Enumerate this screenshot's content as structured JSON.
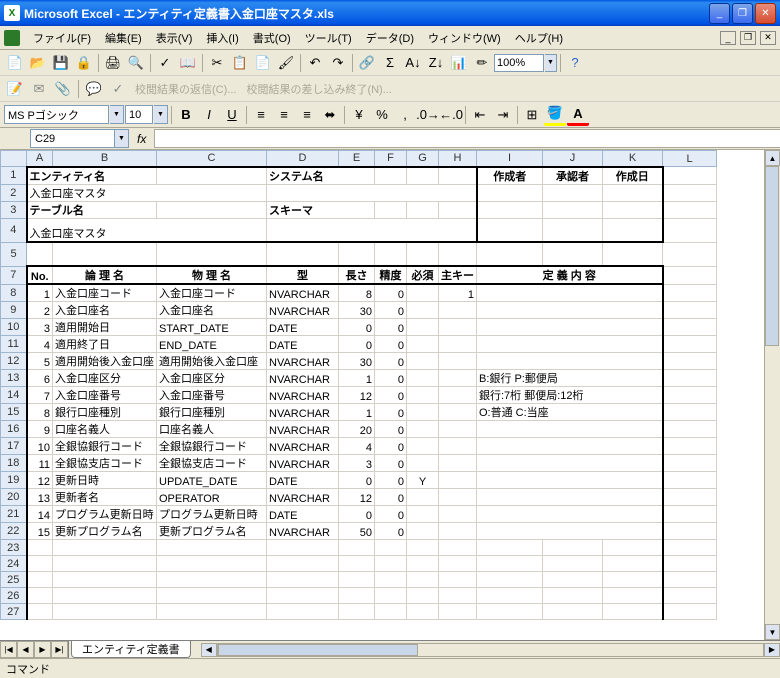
{
  "title": "Microsoft Excel - エンティティ定義書入金口座マスタ.xls",
  "menus": {
    "file": "ファイル(F)",
    "edit": "編集(E)",
    "view": "表示(V)",
    "insert": "挿入(I)",
    "format": "書式(O)",
    "tools": "ツール(T)",
    "data": "データ(D)",
    "window": "ウィンドウ(W)",
    "help": "ヘルプ(H)"
  },
  "toolbar3": {
    "review_reply": "校閲結果の返信(C)...",
    "review_end": "校閲結果の差し込み終了(N)..."
  },
  "format": {
    "font_name": "MS Pゴシック",
    "font_size": "10",
    "zoom": "100%"
  },
  "namebox": "C29",
  "columns": [
    "A",
    "B",
    "C",
    "D",
    "E",
    "F",
    "G",
    "H",
    "I",
    "J",
    "K",
    "L"
  ],
  "header_cells": {
    "entity_label": "エンティティ名",
    "system_label": "システム名",
    "creator": "作成者",
    "approver": "承認者",
    "created_date": "作成日",
    "entity_value": "入金口座マスタ",
    "table_label": "テーブル名",
    "schema_label": "スキーマ",
    "table_value": "入金口座マスタ"
  },
  "column_headers": {
    "no": "No.",
    "logical": "論 理 名",
    "physical": "物 理 名",
    "type": "型",
    "length": "長さ",
    "precision": "精度",
    "required": "必須",
    "pk": "主キー",
    "definition": "定 義 内 容"
  },
  "rows": [
    {
      "no": 1,
      "logical": "入金口座コード",
      "physical": "入金口座コード",
      "type": "NVARCHAR",
      "len": 8,
      "prec": 0,
      "req": "",
      "pk": "1",
      "def": ""
    },
    {
      "no": 2,
      "logical": "入金口座名",
      "physical": "入金口座名",
      "type": "NVARCHAR",
      "len": 30,
      "prec": 0,
      "req": "",
      "pk": "",
      "def": ""
    },
    {
      "no": 3,
      "logical": "適用開始日",
      "physical": "START_DATE",
      "type": "DATE",
      "len": 0,
      "prec": 0,
      "req": "",
      "pk": "",
      "def": ""
    },
    {
      "no": 4,
      "logical": "適用終了日",
      "physical": "END_DATE",
      "type": "DATE",
      "len": 0,
      "prec": 0,
      "req": "",
      "pk": "",
      "def": ""
    },
    {
      "no": 5,
      "logical": "適用開始後入金口座",
      "physical": "適用開始後入金口座",
      "type": "NVARCHAR",
      "len": 30,
      "prec": 0,
      "req": "",
      "pk": "",
      "def": ""
    },
    {
      "no": 6,
      "logical": "入金口座区分",
      "physical": "入金口座区分",
      "type": "NVARCHAR",
      "len": 1,
      "prec": 0,
      "req": "",
      "pk": "",
      "def": "B:銀行 P:郵便局"
    },
    {
      "no": 7,
      "logical": "入金口座番号",
      "physical": "入金口座番号",
      "type": "NVARCHAR",
      "len": 12,
      "prec": 0,
      "req": "",
      "pk": "",
      "def": "銀行:7桁 郵便局:12桁"
    },
    {
      "no": 8,
      "logical": "銀行口座種別",
      "physical": "銀行口座種別",
      "type": "NVARCHAR",
      "len": 1,
      "prec": 0,
      "req": "",
      "pk": "",
      "def": "O:普通 C:当座"
    },
    {
      "no": 9,
      "logical": "口座名義人",
      "physical": "口座名義人",
      "type": "NVARCHAR",
      "len": 20,
      "prec": 0,
      "req": "",
      "pk": "",
      "def": ""
    },
    {
      "no": 10,
      "logical": "全銀協銀行コード",
      "physical": "全銀協銀行コード",
      "type": "NVARCHAR",
      "len": 4,
      "prec": 0,
      "req": "",
      "pk": "",
      "def": ""
    },
    {
      "no": 11,
      "logical": "全銀協支店コード",
      "physical": "全銀協支店コード",
      "type": "NVARCHAR",
      "len": 3,
      "prec": 0,
      "req": "",
      "pk": "",
      "def": ""
    },
    {
      "no": 12,
      "logical": "更新日時",
      "physical": "UPDATE_DATE",
      "type": "DATE",
      "len": 0,
      "prec": 0,
      "req": "Y",
      "pk": "",
      "def": ""
    },
    {
      "no": 13,
      "logical": "更新者名",
      "physical": "OPERATOR",
      "type": "NVARCHAR",
      "len": 12,
      "prec": 0,
      "req": "",
      "pk": "",
      "def": ""
    },
    {
      "no": 14,
      "logical": "プログラム更新日時",
      "physical": "プログラム更新日時",
      "type": "DATE",
      "len": 0,
      "prec": 0,
      "req": "",
      "pk": "",
      "def": ""
    },
    {
      "no": 15,
      "logical": "更新プログラム名",
      "physical": "更新プログラム名",
      "type": "NVARCHAR",
      "len": 50,
      "prec": 0,
      "req": "",
      "pk": "",
      "def": ""
    }
  ],
  "sheet_tab": "エンティティ定義書",
  "status": "コマンド"
}
